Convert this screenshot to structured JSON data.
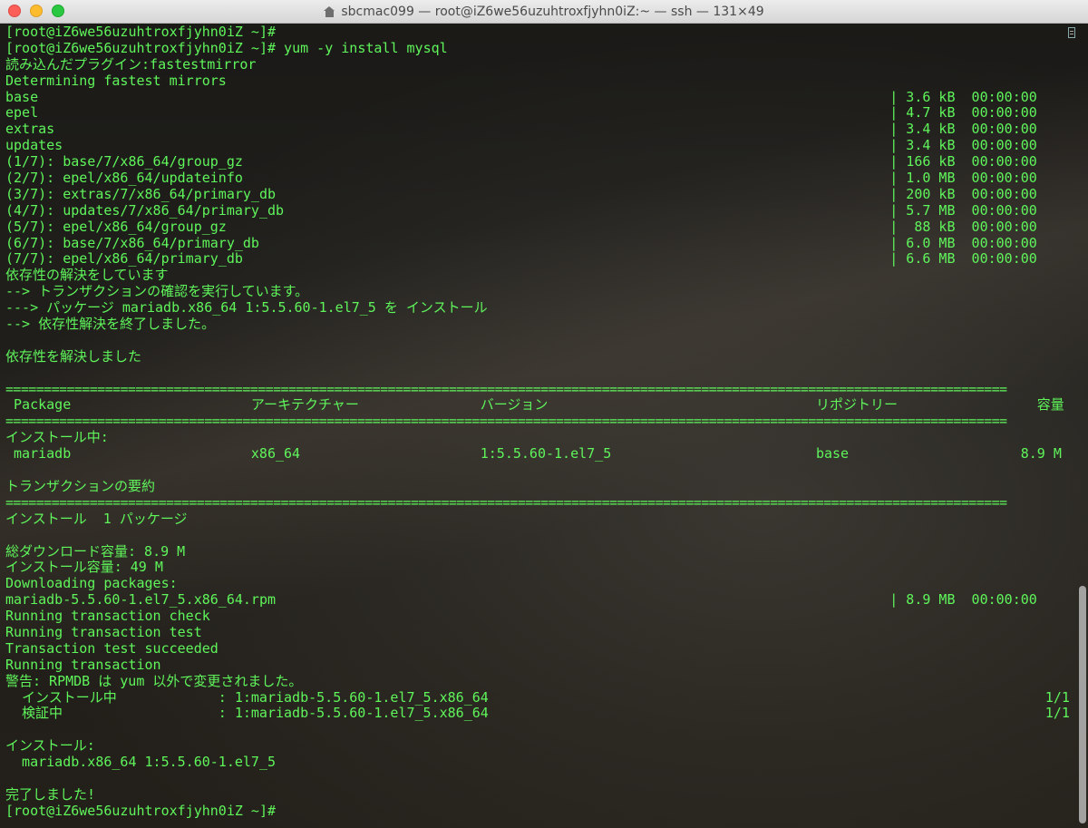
{
  "window": {
    "title": "sbcmac099 — root@iZ6we56uzuhtroxfjyhn0iZ:~ — ssh — 131×49"
  },
  "terminal": {
    "lines": [
      {
        "cols": [
          {
            "t": "[root@iZ6we56uzuhtroxfjyhn0iZ ~]#",
            "c": 0
          }
        ]
      },
      {
        "cols": [
          {
            "t": "[root@iZ6we56uzuhtroxfjyhn0iZ ~]# yum -y install mysql",
            "c": 0
          }
        ]
      },
      {
        "cols": [
          {
            "t": "読み込んだプラグイン:fastestmirror",
            "c": 0
          }
        ]
      },
      {
        "cols": [
          {
            "t": "Determining fastest mirrors",
            "c": 0
          }
        ]
      },
      {
        "cols": [
          {
            "t": "base",
            "c": 0
          },
          {
            "t": "| 3.6 kB  00:00:00",
            "c": 108
          }
        ]
      },
      {
        "cols": [
          {
            "t": "epel",
            "c": 0
          },
          {
            "t": "| 4.7 kB  00:00:00",
            "c": 108
          }
        ]
      },
      {
        "cols": [
          {
            "t": "extras",
            "c": 0
          },
          {
            "t": "| 3.4 kB  00:00:00",
            "c": 108
          }
        ]
      },
      {
        "cols": [
          {
            "t": "updates",
            "c": 0
          },
          {
            "t": "| 3.4 kB  00:00:00",
            "c": 108
          }
        ]
      },
      {
        "cols": [
          {
            "t": "(1/7): base/7/x86_64/group_gz",
            "c": 0
          },
          {
            "t": "| 166 kB  00:00:00",
            "c": 108
          }
        ]
      },
      {
        "cols": [
          {
            "t": "(2/7): epel/x86_64/updateinfo",
            "c": 0
          },
          {
            "t": "| 1.0 MB  00:00:00",
            "c": 108
          }
        ]
      },
      {
        "cols": [
          {
            "t": "(3/7): extras/7/x86_64/primary_db",
            "c": 0
          },
          {
            "t": "| 200 kB  00:00:00",
            "c": 108
          }
        ]
      },
      {
        "cols": [
          {
            "t": "(4/7): updates/7/x86_64/primary_db",
            "c": 0
          },
          {
            "t": "| 5.7 MB  00:00:00",
            "c": 108
          }
        ]
      },
      {
        "cols": [
          {
            "t": "(5/7): epel/x86_64/group_gz",
            "c": 0
          },
          {
            "t": "|  88 kB  00:00:00",
            "c": 108
          }
        ]
      },
      {
        "cols": [
          {
            "t": "(6/7): base/7/x86_64/primary_db",
            "c": 0
          },
          {
            "t": "| 6.0 MB  00:00:00",
            "c": 108
          }
        ]
      },
      {
        "cols": [
          {
            "t": "(7/7): epel/x86_64/primary_db",
            "c": 0
          },
          {
            "t": "| 6.6 MB  00:00:00",
            "c": 108
          }
        ]
      },
      {
        "cols": [
          {
            "t": "依存性の解決をしています",
            "c": 0
          }
        ]
      },
      {
        "cols": [
          {
            "t": "--> トランザクションの確認を実行しています。",
            "c": 0
          }
        ]
      },
      {
        "cols": [
          {
            "t": "---> パッケージ mariadb.x86_64 1:5.5.60-1.el7_5 を インストール",
            "c": 0
          }
        ]
      },
      {
        "cols": [
          {
            "t": "--> 依存性解決を終了しました。",
            "c": 0
          }
        ]
      },
      {
        "cols": []
      },
      {
        "cols": [
          {
            "t": "依存性を解決しました",
            "c": 0
          }
        ]
      },
      {
        "cols": []
      },
      {
        "sep": true
      },
      {
        "cols": [
          {
            "t": "Package",
            "c": 1
          },
          {
            "t": "アーキテクチャー",
            "c": 30
          },
          {
            "t": "バージョン",
            "c": 58
          },
          {
            "t": "リポジトリー",
            "c": 99
          },
          {
            "t": "容量",
            "c": 126
          }
        ]
      },
      {
        "sep": true
      },
      {
        "cols": [
          {
            "t": "インストール中:",
            "c": 0
          }
        ]
      },
      {
        "cols": [
          {
            "t": "mariadb",
            "c": 1
          },
          {
            "t": "x86_64",
            "c": 30
          },
          {
            "t": "1:5.5.60-1.el7_5",
            "c": 58
          },
          {
            "t": "base",
            "c": 99
          },
          {
            "t": "8.9 M",
            "c": 124
          }
        ]
      },
      {
        "cols": []
      },
      {
        "cols": [
          {
            "t": "トランザクションの要約",
            "c": 0
          }
        ]
      },
      {
        "sep": true
      },
      {
        "cols": [
          {
            "t": "インストール  1 パッケージ",
            "c": 0
          }
        ]
      },
      {
        "cols": []
      },
      {
        "cols": [
          {
            "t": "総ダウンロード容量: 8.9 M",
            "c": 0
          }
        ]
      },
      {
        "cols": [
          {
            "t": "インストール容量: 49 M",
            "c": 0
          }
        ]
      },
      {
        "cols": [
          {
            "t": "Downloading packages:",
            "c": 0
          }
        ]
      },
      {
        "cols": [
          {
            "t": "mariadb-5.5.60-1.el7_5.x86_64.rpm",
            "c": 0
          },
          {
            "t": "| 8.9 MB  00:00:00",
            "c": 108
          }
        ]
      },
      {
        "cols": [
          {
            "t": "Running transaction check",
            "c": 0
          }
        ]
      },
      {
        "cols": [
          {
            "t": "Running transaction test",
            "c": 0
          }
        ]
      },
      {
        "cols": [
          {
            "t": "Transaction test succeeded",
            "c": 0
          }
        ]
      },
      {
        "cols": [
          {
            "t": "Running transaction",
            "c": 0
          }
        ]
      },
      {
        "cols": [
          {
            "t": "警告: RPMDB は yum 以外で変更されました。",
            "c": 0
          }
        ]
      },
      {
        "cols": [
          {
            "t": "  インストール中",
            "c": 0
          },
          {
            "t": ": 1:mariadb-5.5.60-1.el7_5.x86_64",
            "c": 26
          },
          {
            "t": "1/1",
            "c": 127
          }
        ]
      },
      {
        "cols": [
          {
            "t": "  検証中",
            "c": 0
          },
          {
            "t": ": 1:mariadb-5.5.60-1.el7_5.x86_64",
            "c": 26
          },
          {
            "t": "1/1",
            "c": 127
          }
        ]
      },
      {
        "cols": []
      },
      {
        "cols": [
          {
            "t": "インストール:",
            "c": 0
          }
        ]
      },
      {
        "cols": [
          {
            "t": "  mariadb.x86_64 1:5.5.60-1.el7_5",
            "c": 0
          }
        ]
      },
      {
        "cols": []
      },
      {
        "cols": [
          {
            "t": "完了しました!",
            "c": 0
          }
        ]
      },
      {
        "cols": [
          {
            "t": "[root@iZ6we56uzuhtroxfjyhn0iZ ~]#",
            "c": 0
          }
        ]
      }
    ]
  },
  "theme": {
    "text_color": "#5ff55b",
    "background": "#222220"
  }
}
